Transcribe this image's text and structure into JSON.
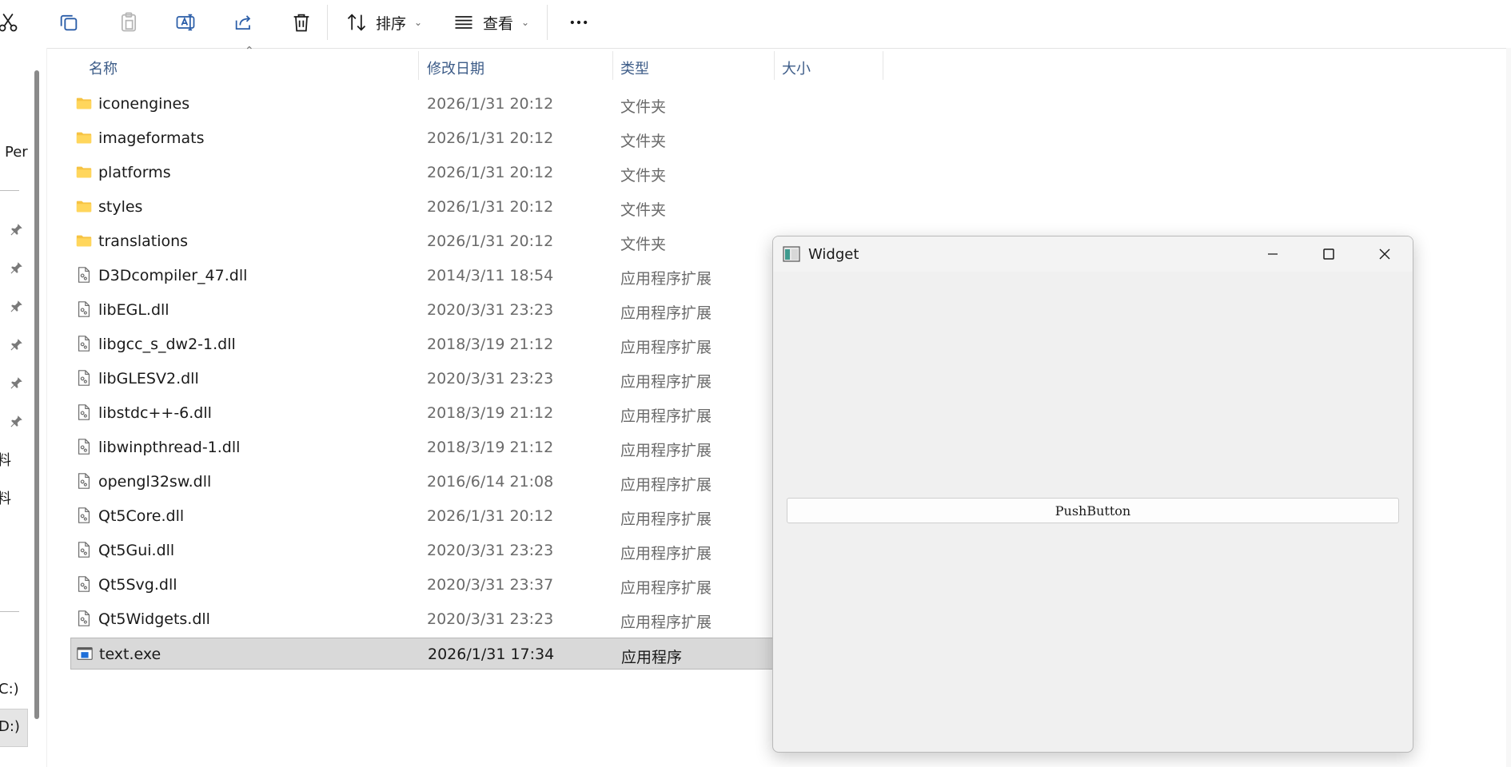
{
  "toolbar": {
    "sort_label": "排序",
    "view_label": "查看"
  },
  "nav": {
    "items": [
      "Per",
      "料",
      "料",
      "C:)",
      "D:)"
    ]
  },
  "columns": {
    "name": "名称",
    "modified": "修改日期",
    "type": "类型",
    "size": "大小"
  },
  "files": [
    {
      "name": "iconengines",
      "date": "2026/1/31 20:12",
      "type": "文件夹",
      "kind": "folder"
    },
    {
      "name": "imageformats",
      "date": "2026/1/31 20:12",
      "type": "文件夹",
      "kind": "folder"
    },
    {
      "name": "platforms",
      "date": "2026/1/31 20:12",
      "type": "文件夹",
      "kind": "folder"
    },
    {
      "name": "styles",
      "date": "2026/1/31 20:12",
      "type": "文件夹",
      "kind": "folder"
    },
    {
      "name": "translations",
      "date": "2026/1/31 20:12",
      "type": "文件夹",
      "kind": "folder"
    },
    {
      "name": "D3Dcompiler_47.dll",
      "date": "2014/3/11 18:54",
      "type": "应用程序扩展",
      "kind": "dll"
    },
    {
      "name": "libEGL.dll",
      "date": "2020/3/31 23:23",
      "type": "应用程序扩展",
      "kind": "dll"
    },
    {
      "name": "libgcc_s_dw2-1.dll",
      "date": "2018/3/19 21:12",
      "type": "应用程序扩展",
      "kind": "dll"
    },
    {
      "name": "libGLESV2.dll",
      "date": "2020/3/31 23:23",
      "type": "应用程序扩展",
      "kind": "dll"
    },
    {
      "name": "libstdc++-6.dll",
      "date": "2018/3/19 21:12",
      "type": "应用程序扩展",
      "kind": "dll"
    },
    {
      "name": "libwinpthread-1.dll",
      "date": "2018/3/19 21:12",
      "type": "应用程序扩展",
      "kind": "dll"
    },
    {
      "name": "opengl32sw.dll",
      "date": "2016/6/14 21:08",
      "type": "应用程序扩展",
      "kind": "dll"
    },
    {
      "name": "Qt5Core.dll",
      "date": "2026/1/31 20:12",
      "type": "应用程序扩展",
      "kind": "dll"
    },
    {
      "name": "Qt5Gui.dll",
      "date": "2020/3/31 23:23",
      "type": "应用程序扩展",
      "kind": "dll"
    },
    {
      "name": "Qt5Svg.dll",
      "date": "2020/3/31 23:37",
      "type": "应用程序扩展",
      "kind": "dll"
    },
    {
      "name": "Qt5Widgets.dll",
      "date": "2020/3/31 23:23",
      "type": "应用程序扩展",
      "kind": "dll"
    },
    {
      "name": "text.exe",
      "date": "2026/1/31 17:34",
      "type": "应用程序",
      "kind": "exe",
      "selected": true
    }
  ],
  "widget": {
    "title": "Widget",
    "button_label": "PushButton"
  },
  "icons": {
    "toolbar": [
      "cut-icon",
      "copy-icon",
      "paste-icon",
      "rename-icon",
      "share-icon",
      "delete-icon",
      "sort-icon",
      "view-icon",
      "more-icon"
    ],
    "folder": "folder-icon",
    "dll": "dll-file-icon",
    "exe": "exe-file-icon",
    "pin": "pin-icon"
  },
  "colors": {
    "folder": "#f6c343",
    "header_text": "#3d5c88",
    "selection": "#d9d9d9",
    "qt_window_bg": "#f0f0f0"
  }
}
